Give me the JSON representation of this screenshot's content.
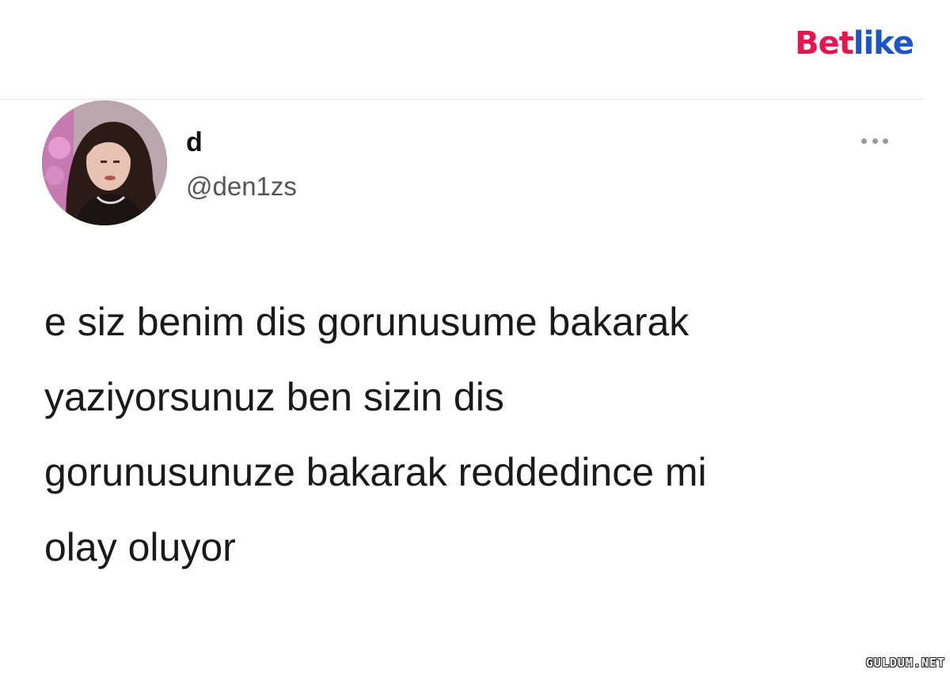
{
  "brand": {
    "logo_bet": "Bet",
    "logo_like": "like",
    "colors": {
      "bet": "#e5164f",
      "like": "#1d55c8"
    }
  },
  "tweet": {
    "display_name": "d",
    "handle": "@den1zs",
    "more_icon": "more-horizontal-icon",
    "text_lines": [
      "e siz benim dis gorunusume bakarak",
      "yaziyorsunuz ben sizin dis",
      "gorunusunuze bakarak reddedince mi",
      "olay oluyor"
    ]
  },
  "watermark": {
    "text": "GULDUM.NET"
  }
}
